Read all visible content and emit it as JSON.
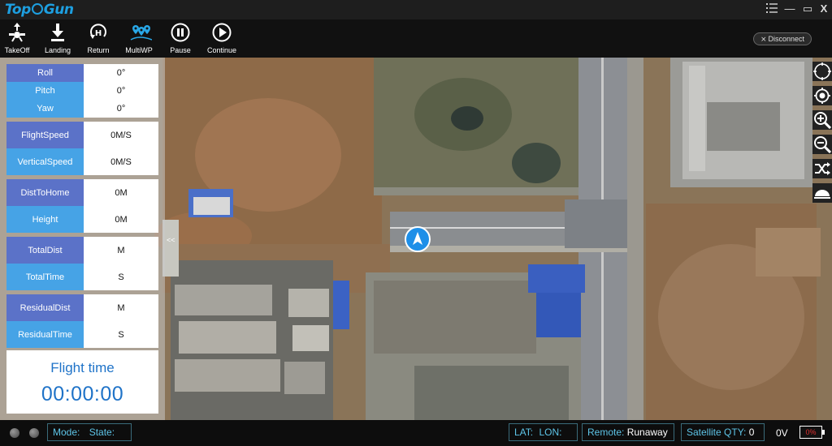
{
  "app": {
    "logo_text_a": "Top",
    "logo_text_b": "Gun"
  },
  "window": {
    "menu_icon": "list-menu-icon",
    "minimize_glyph": "—",
    "maximize_glyph": "▭",
    "close_glyph": "X"
  },
  "toolbar": {
    "items": [
      {
        "label": "TakeOff",
        "icon": "takeoff-icon"
      },
      {
        "label": "Landing",
        "icon": "landing-icon"
      },
      {
        "label": "Return",
        "icon": "return-home-icon"
      },
      {
        "label": "MultiWP",
        "icon": "multi-waypoint-icon"
      },
      {
        "label": "Pause",
        "icon": "pause-icon"
      },
      {
        "label": "Continue",
        "icon": "play-icon"
      }
    ],
    "disconnect_label": "Disconnect"
  },
  "telemetry": {
    "roll": {
      "label": "Roll",
      "value": "0°"
    },
    "pitch": {
      "label": "Pitch",
      "value": "0°"
    },
    "yaw": {
      "label": "Yaw",
      "value": "0°"
    },
    "flight_speed": {
      "label": "FlightSpeed",
      "value": "0M/S"
    },
    "vertical_speed": {
      "label": "VerticalSpeed",
      "value": "0M/S"
    },
    "dist_to_home": {
      "label": "DistToHome",
      "value": "0M"
    },
    "height": {
      "label": "Height",
      "value": "0M"
    },
    "total_dist": {
      "label": "TotalDist",
      "value": "M"
    },
    "total_time": {
      "label": "TotalTime",
      "value": "S"
    },
    "residual_dist": {
      "label": "ResidualDist",
      "value": "M"
    },
    "residual_time": {
      "label": "ResidualTime",
      "value": "S"
    },
    "flight_time_label": "Flight time",
    "flight_time_value": "00:00:00",
    "collapse_glyph": "<<"
  },
  "map_tools": [
    "compass-icon",
    "locate-icon",
    "zoom-in-icon",
    "zoom-out-icon",
    "shuffle-icon",
    "dome-icon"
  ],
  "status": {
    "mode_label": "Mode:",
    "state_label": "State:",
    "lat_label": "LAT:",
    "lon_label": "LON:",
    "remote_label": "Remote:",
    "remote_value": "Runaway",
    "satellite_label": "Satellite QTY:",
    "satellite_value": "0",
    "voltage": "0V",
    "battery": "0%"
  },
  "colors": {
    "accent": "#1d9fe0",
    "label_dark": "#5b72c8",
    "label_light": "#46a3e6",
    "battery_text": "#e03030",
    "status_text": "#5ec5e8"
  }
}
